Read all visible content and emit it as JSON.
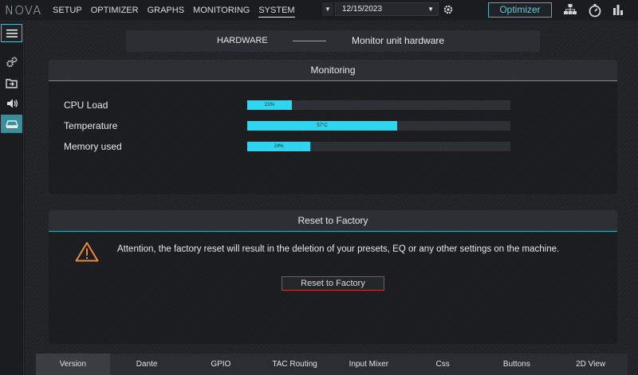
{
  "app": {
    "logo": "NOVA"
  },
  "nav": [
    {
      "label": "SETUP"
    },
    {
      "label": "OPTIMIZER"
    },
    {
      "label": "GRAPHS"
    },
    {
      "label": "MONITORING"
    },
    {
      "label": "SYSTEM",
      "active": true
    }
  ],
  "toolbar": {
    "date_value": "12/15/2023",
    "optimizer_label": "Optimizer"
  },
  "icons": {
    "drop_arrow": "caret-down-icon",
    "settings": "gear-icon",
    "network": "network-icon",
    "timer": "stopwatch-icon",
    "levels": "bar-meter-icon"
  },
  "sidebar": {
    "items": [
      {
        "icon": "menu-icon"
      },
      {
        "icon": "gears-icon"
      },
      {
        "icon": "folder-import-icon"
      },
      {
        "icon": "speaker-icon"
      },
      {
        "icon": "hardware-device-icon",
        "active": true
      }
    ]
  },
  "header": {
    "left": "HARDWARE",
    "right": "Monitor unit hardware"
  },
  "monitoring": {
    "title": "Monitoring",
    "rows": [
      {
        "label": "CPU Load",
        "value_text": "21%",
        "level": 0.17
      },
      {
        "label": "Temperature",
        "value_text": "57°C",
        "level": 0.57
      },
      {
        "label": "Memory used",
        "value_text": "24%",
        "level": 0.24
      }
    ]
  },
  "reset": {
    "title": "Reset to Factory",
    "warning": "Attention, the factory reset will result in the deletion of your presets, EQ or any other settings on the machine.",
    "button_label": "Reset to Factory"
  },
  "tabs": [
    {
      "label": "Version",
      "active": true
    },
    {
      "label": "Dante"
    },
    {
      "label": "GPIO"
    },
    {
      "label": "TAC Routing"
    },
    {
      "label": "Input Mixer"
    },
    {
      "label": "Css"
    },
    {
      "label": "Buttons"
    },
    {
      "label": "2D View"
    }
  ],
  "colors": {
    "accent": "#2fd5ee",
    "optimizer_border": "#3fb3c4",
    "danger": "#c23b33",
    "sidebar_active": "#3a8e99",
    "warning_icon": "#e8893a"
  }
}
